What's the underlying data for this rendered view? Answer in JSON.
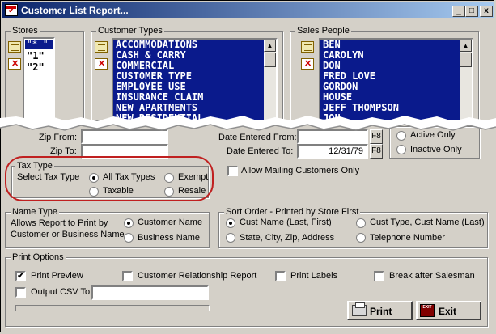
{
  "window": {
    "title": "Customer List Report...",
    "controls": {
      "minimize": "_",
      "maximize": "□",
      "close": "x"
    }
  },
  "stores": {
    "label": "Stores",
    "items": [
      "\"* \"",
      "\"1\"",
      "\"2\""
    ]
  },
  "customer_types": {
    "label": "Customer Types",
    "items": [
      "ACCOMMODATIONS",
      "CASH & CARRY",
      "COMMERCIAL",
      "CUSTOMER TYPE",
      "EMPLOYEE USE",
      "INSURANCE CLAIM",
      "NEW APARTMENTS",
      "NEW RESIDENTIAL"
    ]
  },
  "sales_people": {
    "label": "Sales People",
    "items": [
      "BEN",
      "CAROLYN",
      "DON",
      "FRED LOVE",
      "GORDON",
      "HOUSE",
      "JEFF THOMPSON",
      "JOH"
    ]
  },
  "zip": {
    "from_label": "Zip From:",
    "from_value": "",
    "to_label": "Zip To:",
    "to_value": ""
  },
  "dates": {
    "from_label": "Date Entered From:",
    "from_value": "",
    "to_label": "Date Entered To:",
    "to_value": "12/31/79",
    "f8": "F8"
  },
  "status": {
    "active_only": "Active Only",
    "inactive_only": "Inactive Only"
  },
  "allow_mailing": {
    "label": "Allow Mailing Customers Only",
    "checked": false
  },
  "tax_type": {
    "label": "Tax Type",
    "prompt": "Select Tax Type",
    "options": [
      "All Tax Types",
      "Exempt",
      "Taxable",
      "Resale"
    ],
    "selected": "All Tax Types"
  },
  "name_type": {
    "label": "Name Type",
    "description_line1": "Allows Report to Print by",
    "description_line2": "Customer or Business Name",
    "options": [
      "Customer Name",
      "Business Name"
    ],
    "selected": "Customer Name"
  },
  "sort_order": {
    "label": "Sort Order - Printed by Store First",
    "options": [
      "Cust Name (Last, First)",
      "Cust Type, Cust Name (Last)",
      "State, City, Zip, Address",
      "Telephone Number"
    ],
    "selected": "Cust Name (Last, First)"
  },
  "print_options": {
    "label": "Print Options",
    "print_preview": {
      "label": "Print Preview",
      "checked": true
    },
    "customer_relationship": {
      "label": "Customer Relationship Report",
      "checked": false
    },
    "print_labels": {
      "label": "Print Labels",
      "checked": false
    },
    "break_after_salesman": {
      "label": "Break after Salesman",
      "checked": false
    },
    "output_csv": {
      "label": "Output CSV To:",
      "checked": false,
      "value": ""
    }
  },
  "buttons": {
    "print": "Print",
    "exit": "Exit",
    "exit_icon_text": "EXIT"
  }
}
